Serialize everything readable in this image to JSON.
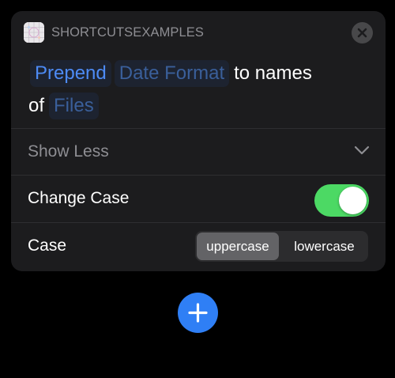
{
  "app": {
    "name": "SHORTCUTSEXAMPLES",
    "icon": "shortcuts-app-icon"
  },
  "action": {
    "sentence": {
      "verb": "Prepend",
      "format_token": "Date Format",
      "connector": "to names",
      "of_label": "of",
      "files_token": "Files"
    }
  },
  "show_less": {
    "label": "Show Less",
    "icon": "chevron-down-icon"
  },
  "change_case": {
    "label": "Change Case",
    "enabled": true
  },
  "case": {
    "label": "Case",
    "options": [
      "uppercase",
      "lowercase"
    ],
    "selected": "uppercase"
  },
  "add_button": {
    "icon": "plus-icon"
  },
  "colors": {
    "background": "#000000",
    "card": "#1c1c1e",
    "accent_blue": "#4d8bf5",
    "toggle_on": "#4cd964",
    "add_button": "#2f7ff5"
  }
}
